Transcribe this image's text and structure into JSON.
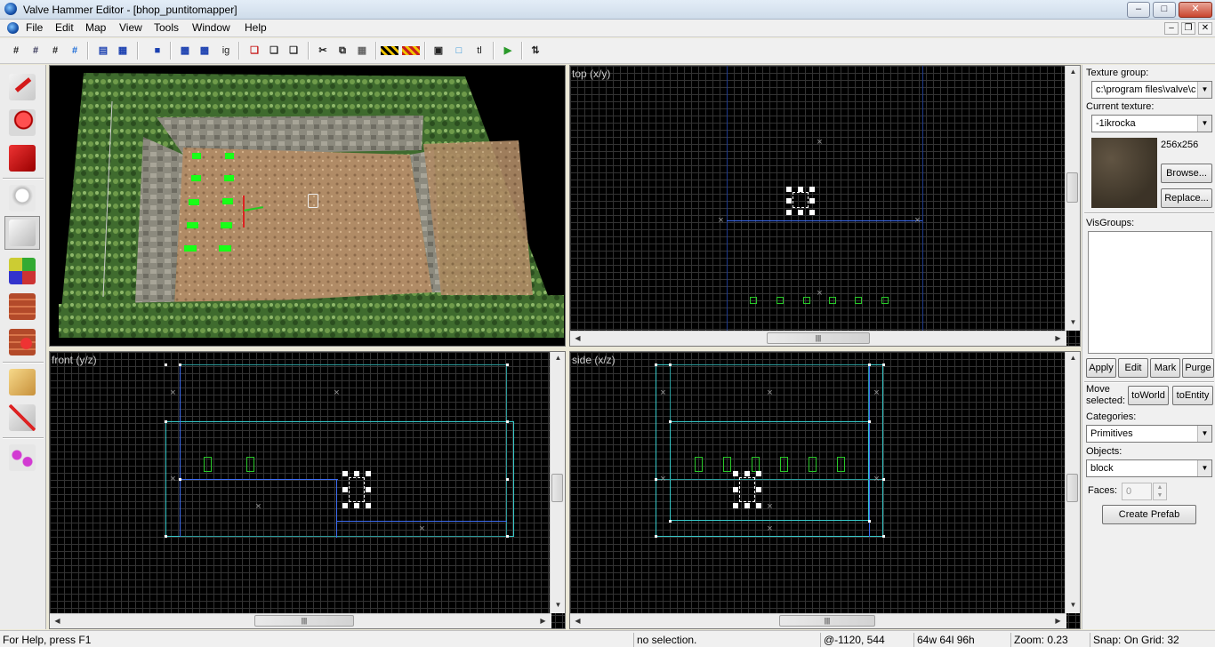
{
  "window": {
    "title": "Valve Hammer Editor - [bhop_puntitomapper]",
    "minimize": "–",
    "maximize": "□",
    "close": "✕"
  },
  "menubar": {
    "items": [
      "File",
      "Edit",
      "Map",
      "View",
      "Tools",
      "Window",
      "Help"
    ],
    "mdi_min": "–",
    "mdi_restore": "❐",
    "mdi_close": "✕"
  },
  "toolbar": {
    "icons": [
      "grid-toggle",
      "grid-3d",
      "grid-smaller",
      "grid-larger",
      "group",
      "ungroup",
      "hide-selected",
      "carve",
      "hollow",
      "ignore-groups",
      "hide-items",
      "show-all",
      "to-entity",
      "copy",
      "paste",
      "cut",
      "texture-lock",
      "texture-application",
      "texture-lock-2",
      "vertex-manipulation",
      "clipping",
      "text-tool",
      "run-map",
      "flip"
    ],
    "ig_label": "ig",
    "tl_label": "tl"
  },
  "tools": [
    "selection-tool",
    "magnify-tool",
    "camera-tool",
    "entity-tool",
    "block-tool",
    "texture-application-tool",
    "apply-current-texture",
    "decal-tool",
    "overlay-tool",
    "clipping-tool",
    "vertex-tool",
    "path-tool"
  ],
  "viewports": {
    "top": {
      "label": "top (x/y)"
    },
    "front": {
      "label": "front (y/z)"
    },
    "side": {
      "label": "side (x/z)"
    },
    "camera": {
      "label": ""
    }
  },
  "scroll": {
    "thumb_glyph": "|||",
    "up": "▲",
    "down": "▼",
    "left": "◀",
    "right": "▶"
  },
  "panel": {
    "texture_group_label": "Texture group:",
    "texture_group_value": "c:\\program files\\valve\\c",
    "current_texture_label": "Current texture:",
    "current_texture_value": "-1ikrocka",
    "texture_size": "256x256",
    "browse": "Browse...",
    "replace": "Replace...",
    "visgroups_label": "VisGroups:",
    "apply": "Apply",
    "edit": "Edit",
    "mark": "Mark",
    "purge": "Purge",
    "move_selected": "Move selected:",
    "to_world": "toWorld",
    "to_entity": "toEntity",
    "categories_label": "Categories:",
    "categories_value": "Primitives",
    "objects_label": "Objects:",
    "objects_value": "block",
    "faces_label": "Faces:",
    "faces_value": "0",
    "create_prefab": "Create Prefab"
  },
  "status": {
    "help": "For Help, press F1",
    "selection": "no selection.",
    "coords": "@-1120, 544",
    "size": "64w 64l 96h",
    "zoom": "Zoom: 0.23",
    "snap": "Snap: On Grid: 32"
  },
  "colors": {
    "brush": "#3d6cf2",
    "selected_outline": "#35c8c8",
    "entity": "#29c829",
    "grid": "#333333"
  }
}
